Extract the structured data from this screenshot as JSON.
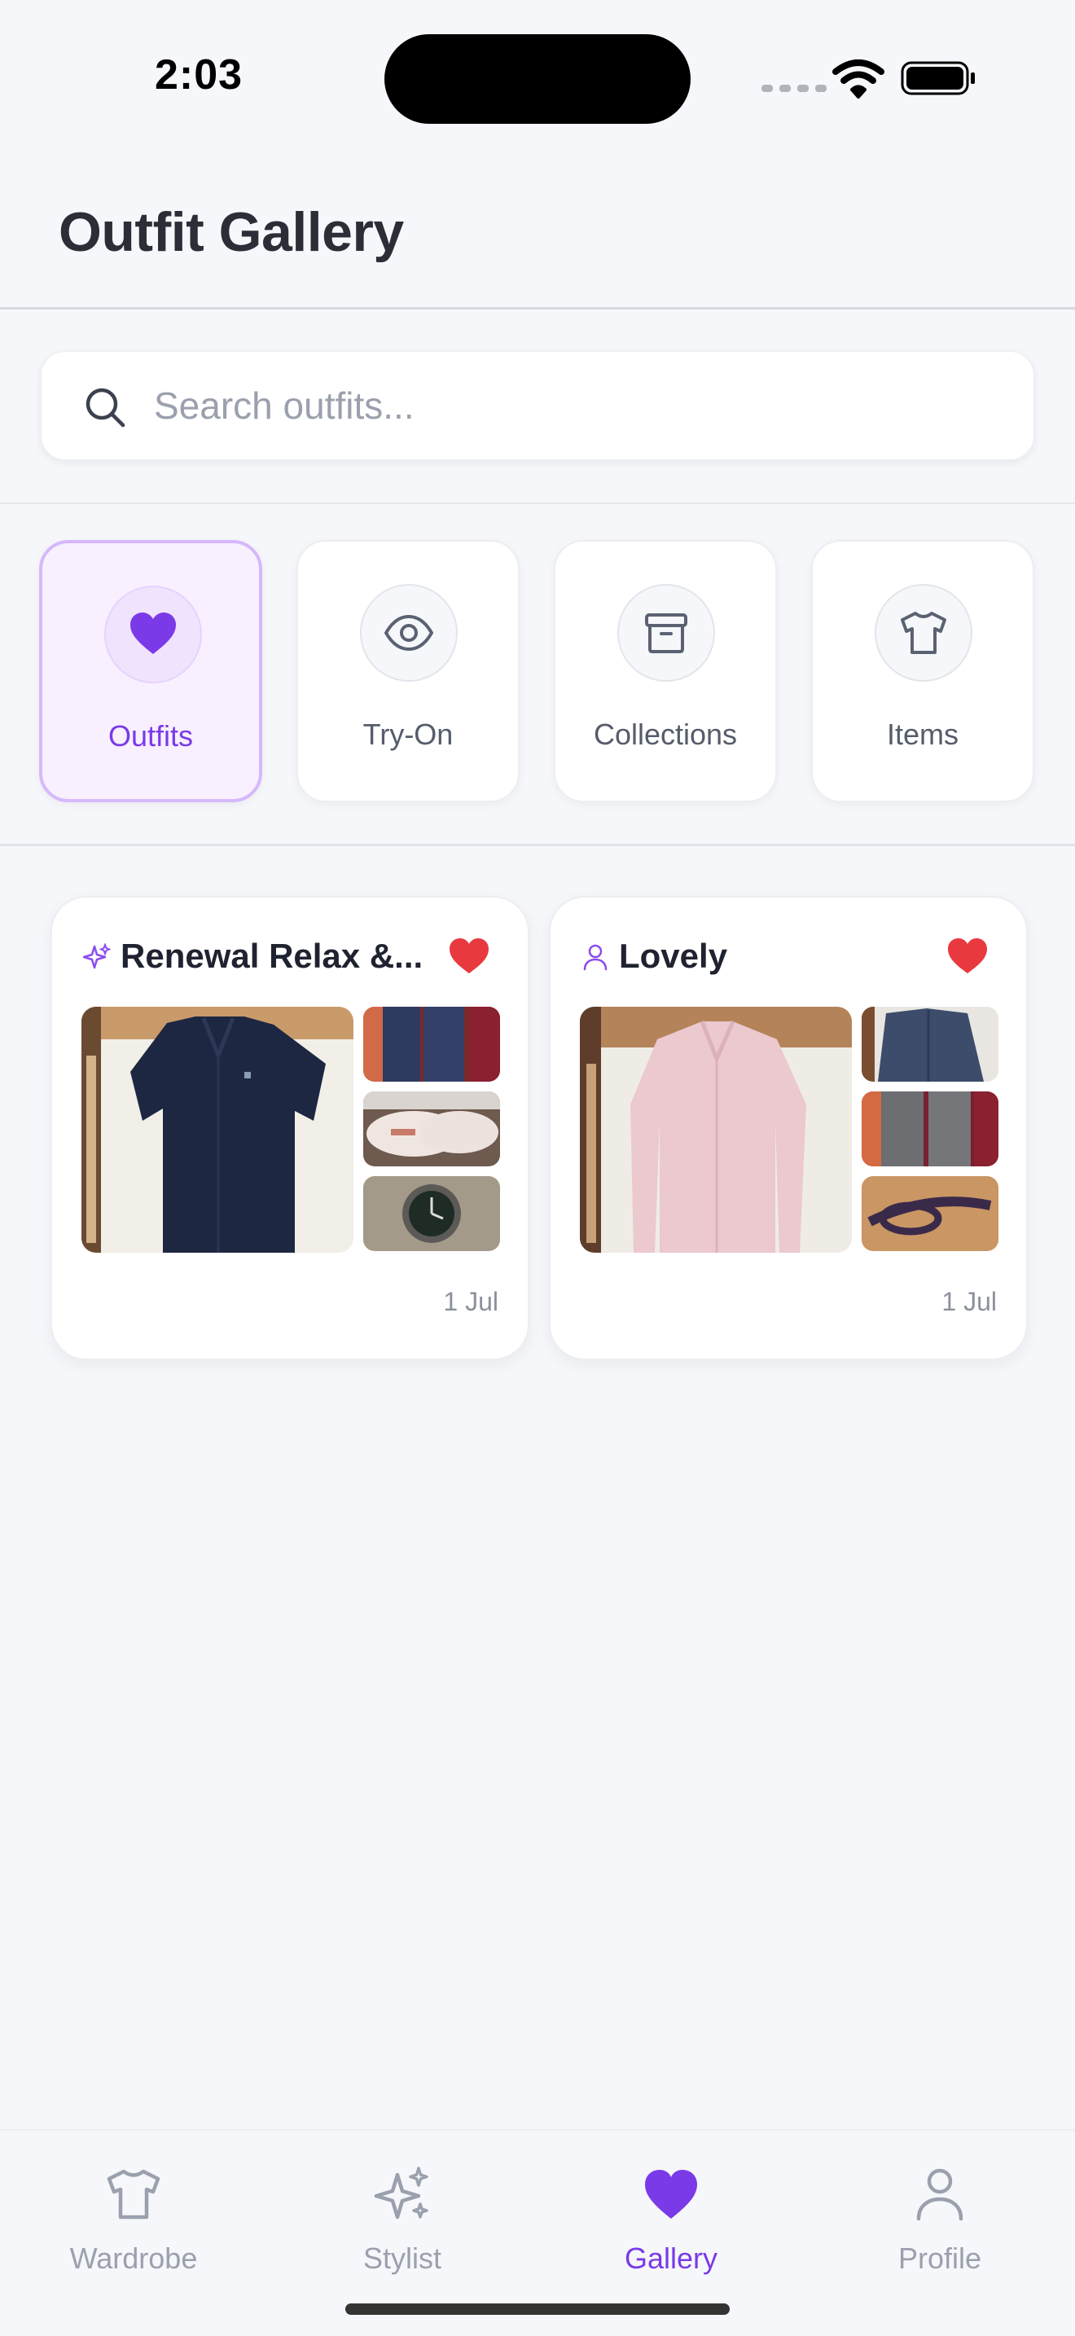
{
  "status_bar": {
    "time": "2:03"
  },
  "header": {
    "title": "Outfit Gallery"
  },
  "search": {
    "placeholder": "Search outfits..."
  },
  "categories": [
    {
      "label": "Outfits",
      "icon": "heart-icon",
      "active": true
    },
    {
      "label": "Try-On",
      "icon": "eye-icon",
      "active": false
    },
    {
      "label": "Collections",
      "icon": "archive-box-icon",
      "active": false
    },
    {
      "label": "Items",
      "icon": "tshirt-icon",
      "active": false
    }
  ],
  "outfits": [
    {
      "title": "Renewal Relax &...",
      "type_icon": "sparkles-icon",
      "favorite": true,
      "date": "1 Jul",
      "images": [
        "navy-shirt",
        "navy-trousers",
        "white-sneakers",
        "wristwatch"
      ]
    },
    {
      "title": "Lovely",
      "type_icon": "person-icon",
      "favorite": true,
      "date": "1 Jul",
      "images": [
        "pink-shirt",
        "denim-jacket",
        "grey-trousers",
        "brown-belt"
      ]
    }
  ],
  "tabbar": [
    {
      "label": "Wardrobe",
      "icon": "tshirt-icon",
      "active": false
    },
    {
      "label": "Stylist",
      "icon": "sparkles-icon",
      "active": false
    },
    {
      "label": "Gallery",
      "icon": "heart-icon",
      "active": true
    },
    {
      "label": "Profile",
      "icon": "person-icon",
      "active": false
    }
  ],
  "colors": {
    "accent": "#7a3ae8",
    "favorite": "#e8393f",
    "background": "#f6f7fa"
  }
}
